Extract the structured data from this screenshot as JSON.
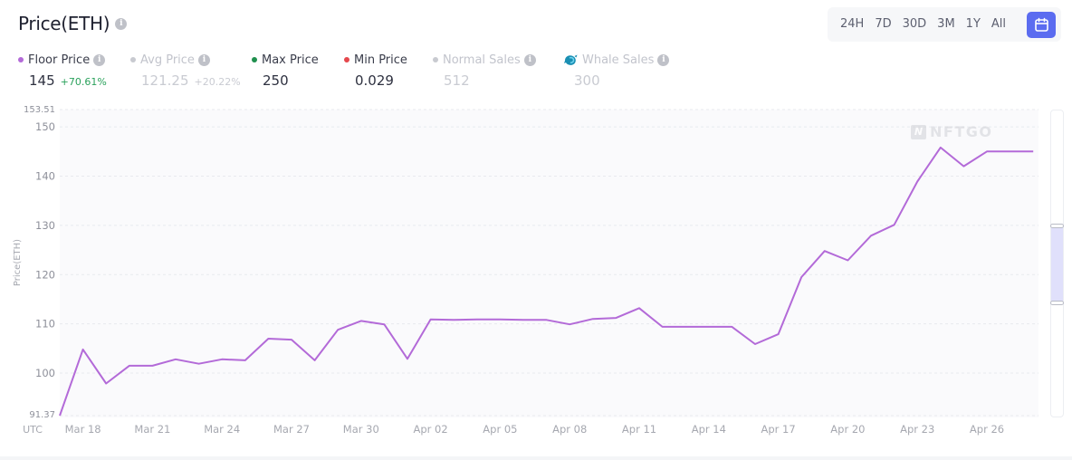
{
  "header": {
    "title": "Price(ETH)",
    "title_info_icon": "info-icon"
  },
  "time_range": {
    "options": [
      "24H",
      "7D",
      "30D",
      "3M",
      "1Y",
      "All"
    ],
    "calendar_icon": "calendar-icon",
    "active": "calendar",
    "active_color": "#5b6cf0"
  },
  "metrics": [
    {
      "label": "Floor Price",
      "value": "145",
      "change": "+70.61%",
      "dot_color": "#b36ad8",
      "info": true,
      "active": true
    },
    {
      "label": "Avg Price",
      "value": "121.25",
      "change": "+20.22%",
      "dot_color": "#c8cad0",
      "info": true,
      "active": false
    },
    {
      "label": "Max Price",
      "value": "250",
      "change": "",
      "dot_color": "#1f8f4e",
      "info": false,
      "active": true
    },
    {
      "label": "Min Price",
      "value": "0.029",
      "change": "",
      "dot_color": "#e5484d",
      "info": false,
      "active": true
    },
    {
      "label": "Normal Sales",
      "value": "512",
      "change": "",
      "dot_color": "#c8cad0",
      "info": true,
      "active": false
    },
    {
      "label": "Whale Sales",
      "value": "300",
      "change": "",
      "icon": "whale-icon",
      "info": true,
      "active": false
    }
  ],
  "watermark": {
    "text": "NFTGO",
    "logo": "N"
  },
  "scroll": {
    "range_start_fraction": 0.38,
    "range_end_fraction": 0.63
  },
  "chart_data": {
    "type": "line",
    "title": "",
    "xlabel": "UTC",
    "ylabel": "Price(ETH)",
    "ylim": [
      91.37,
      153.51
    ],
    "y_ticks": [
      "153.51",
      "150",
      "140",
      "130",
      "120",
      "110",
      "100",
      "91.37"
    ],
    "x_tick_labels": [
      "Mar 18",
      "Mar 21",
      "Mar 24",
      "Mar 27",
      "Mar 30",
      "Apr 02",
      "Apr 05",
      "Apr 08",
      "Apr 11",
      "Apr 14",
      "Apr 17",
      "Apr 20",
      "Apr 23",
      "Apr 26"
    ],
    "grid": true,
    "series": [
      {
        "name": "Floor Price",
        "color": "#b36ad8",
        "x": [
          "Mar 17",
          "Mar 18",
          "Mar 19",
          "Mar 20",
          "Mar 21",
          "Mar 22",
          "Mar 23",
          "Mar 24",
          "Mar 25",
          "Mar 26",
          "Mar 27",
          "Mar 28",
          "Mar 29",
          "Mar 30",
          "Mar 31",
          "Apr 01",
          "Apr 02",
          "Apr 03",
          "Apr 04",
          "Apr 05",
          "Apr 06",
          "Apr 07",
          "Apr 08",
          "Apr 09",
          "Apr 10",
          "Apr 11",
          "Apr 12",
          "Apr 13",
          "Apr 14",
          "Apr 15",
          "Apr 16",
          "Apr 17",
          "Apr 18",
          "Apr 19",
          "Apr 20",
          "Apr 21",
          "Apr 22",
          "Apr 23",
          "Apr 24",
          "Apr 25",
          "Apr 26",
          "Apr 27",
          "Apr 28"
        ],
        "values": [
          91.37,
          104.8,
          97.9,
          101.5,
          101.5,
          102.8,
          101.9,
          102.8,
          102.6,
          107.0,
          106.8,
          102.6,
          108.8,
          110.6,
          109.9,
          102.9,
          110.9,
          110.8,
          110.9,
          110.9,
          110.8,
          110.8,
          109.9,
          111.0,
          111.2,
          113.2,
          109.4,
          109.4,
          109.4,
          109.4,
          105.9,
          107.9,
          119.5,
          124.8,
          122.9,
          127.9,
          130.1,
          138.9,
          145.8,
          142.0,
          145.0,
          145.0,
          145.0
        ]
      }
    ]
  }
}
